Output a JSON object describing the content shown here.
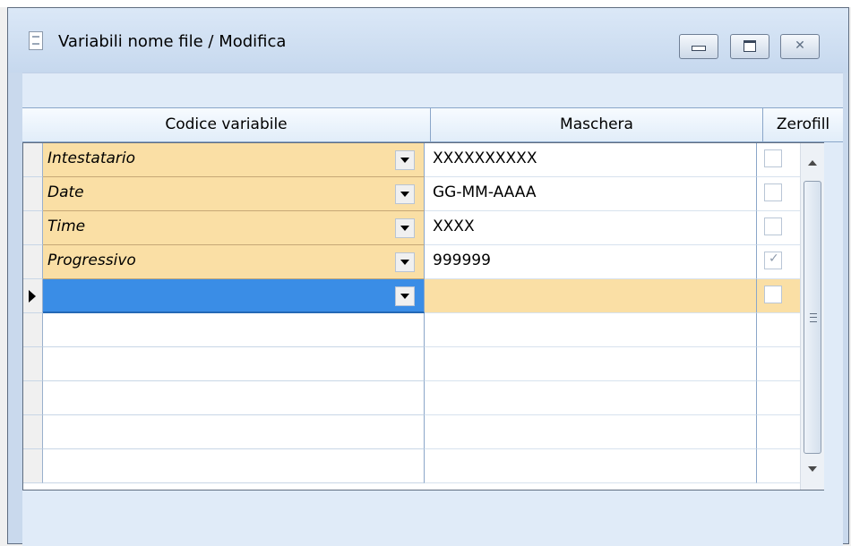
{
  "window": {
    "title": "Variabili nome file / Modifica"
  },
  "grid": {
    "columns": [
      "Codice variabile",
      "Maschera",
      "Zerofill"
    ],
    "rows": [
      {
        "code": "Intestatario",
        "mask": "XXXXXXXXXX",
        "zerofill": false
      },
      {
        "code": "Date",
        "mask": "GG-MM-AAAA",
        "zerofill": false
      },
      {
        "code": "Time",
        "mask": "XXXX",
        "zerofill": false
      },
      {
        "code": "Progressivo",
        "mask": "999999",
        "zerofill": true
      },
      {
        "code": "",
        "mask": "",
        "zerofill": false
      }
    ]
  },
  "colors": {
    "window_blue": "#c9d9ed",
    "selected_blue": "#3a8de6",
    "entry_cream": "#fadfa5"
  },
  "icons": [
    "document-icon",
    "minimize-icon",
    "maximize-icon",
    "close-icon",
    "dropdown-arrow-icon",
    "row-pointer-icon",
    "scroll-up-icon",
    "scroll-down-icon"
  ]
}
